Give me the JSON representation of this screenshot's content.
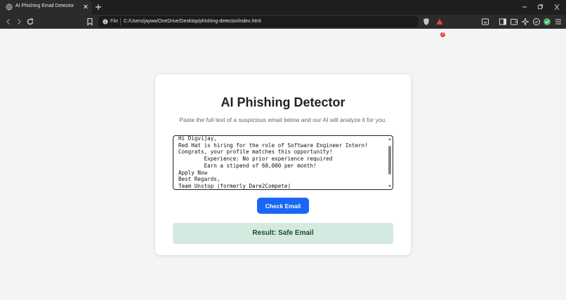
{
  "browser": {
    "tab": {
      "title": "AI Phishing Email Detector"
    },
    "address_bar": {
      "scheme_label": "File",
      "url": "C:/Users/jaywa/OneDrive/Desktop/phishing-detector/index.html"
    },
    "notification_count": "2",
    "icons": [
      "globe-icon",
      "close-icon",
      "plus-icon",
      "minimize-icon",
      "restore-icon",
      "back-icon",
      "forward-icon",
      "reload-icon",
      "bookmark-icon",
      "info-icon",
      "brave-shield-icon",
      "rewards-icon",
      "cast-icon",
      "sidebar-icon",
      "wallet-icon",
      "ai-sparkle-icon",
      "vpn-icon",
      "extension-icon",
      "menu-icon"
    ]
  },
  "page": {
    "title": "AI Phishing Detector",
    "subtitle": "Paste the full text of a suspicious email below and our AI will analyze it for you.",
    "email_text": "Hi Digvijay,\nRed Hat is hiring for the role of Software Engineer Intern!\nCongrats, your profile matches this opportunity!\n        Experience: No prior experience required\n        Earn a stipend of 60,000 per month!\nApply Now\nBest Regards,\nTeam Unstop (formerly Dare2Compete)",
    "check_button": "Check Email",
    "result": "Result: Safe Email",
    "colors": {
      "button": "#1a66f5",
      "result_bg": "#d4e9df",
      "result_text": "#1a4d32",
      "page_bg": "#f3f4f6"
    }
  }
}
